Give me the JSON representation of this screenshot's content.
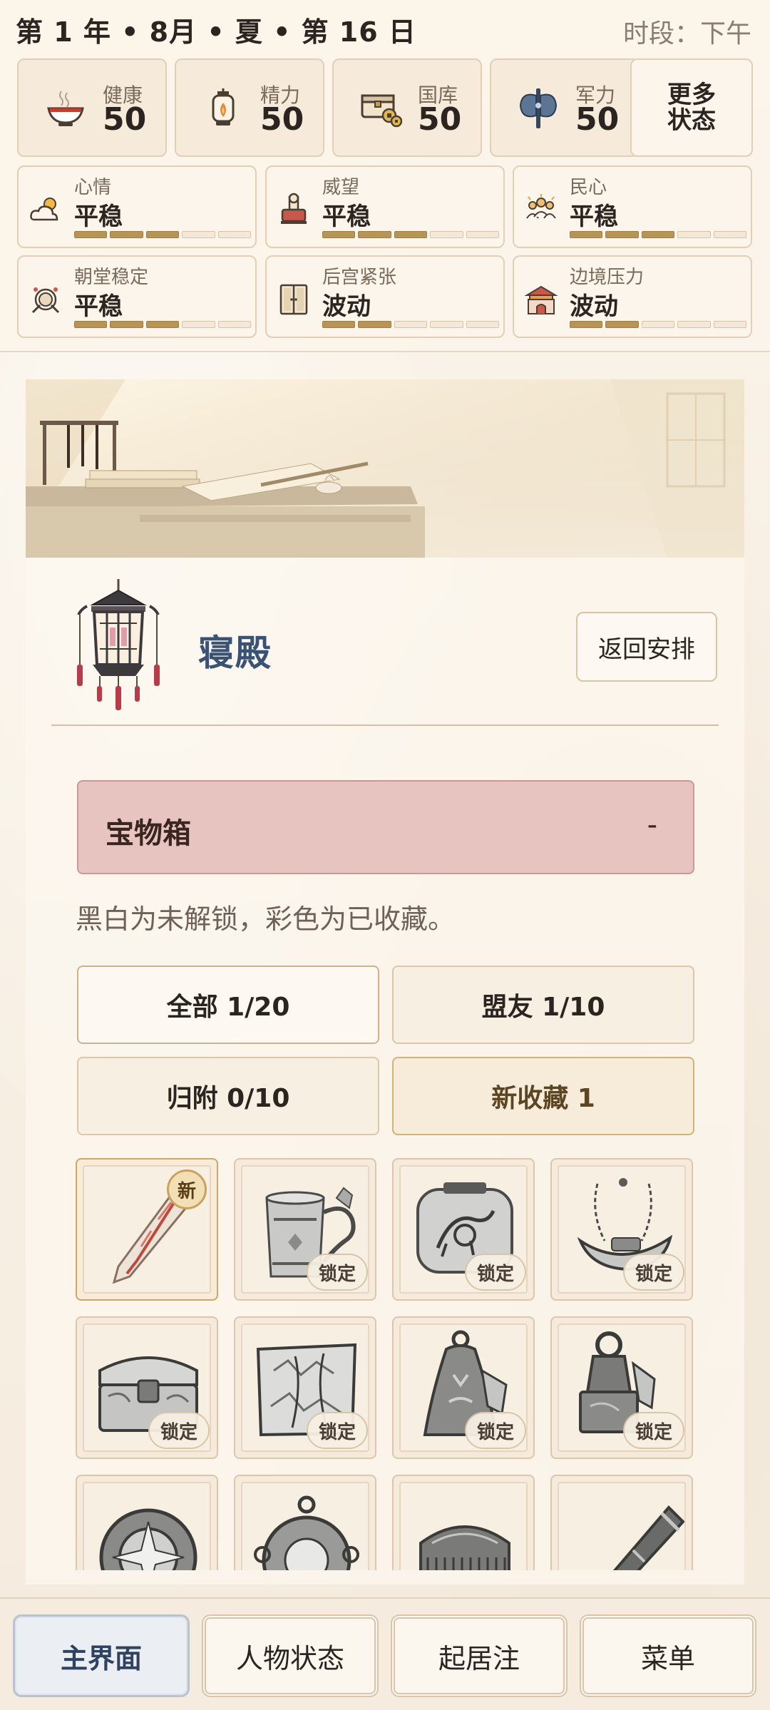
{
  "header": {
    "date": "第 1 年 • 8月 • 夏 • 第 16 日",
    "period": "时段：下午"
  },
  "resources": [
    {
      "icon": "bowl-icon",
      "label": "健康",
      "value": "50"
    },
    {
      "icon": "lantern-icon",
      "label": "精力",
      "value": "50"
    },
    {
      "icon": "treasury-icon",
      "label": "国库",
      "value": "50"
    },
    {
      "icon": "axe-icon",
      "label": "军力",
      "value": "50"
    }
  ],
  "more_status": "更多\n状态",
  "stats": [
    {
      "icon": "weather-icon",
      "label": "心情",
      "value": "平稳",
      "level": 3
    },
    {
      "icon": "seal-icon",
      "label": "威望",
      "value": "平稳",
      "level": 3
    },
    {
      "icon": "people-icon",
      "label": "民心",
      "value": "平稳",
      "level": 3
    },
    {
      "icon": "drum-icon",
      "label": "朝堂稳定",
      "value": "平稳",
      "level": 3
    },
    {
      "icon": "door-icon",
      "label": "后宫紧张",
      "value": "波动",
      "level": 2
    },
    {
      "icon": "gate-icon",
      "label": "边境压力",
      "value": "波动",
      "level": 2
    }
  ],
  "location": {
    "name": "寝殿",
    "back_label": "返回安排"
  },
  "treasure": {
    "title": "宝物箱",
    "toggle": "-",
    "hint": "黑白为未解锁，彩色为已收藏。",
    "filters": [
      {
        "label": "全部 1/20",
        "state": "active"
      },
      {
        "label": "盟友 1/10",
        "state": "normal"
      },
      {
        "label": "归附 0/10",
        "state": "normal"
      },
      {
        "label": "新收藏 1",
        "state": "new"
      }
    ],
    "lock_label": "锁定",
    "new_label": "新",
    "items": [
      {
        "icon": "dagger-icon",
        "owned": true
      },
      {
        "icon": "horse-cup-icon",
        "owned": false
      },
      {
        "icon": "horse-plaque-icon",
        "owned": false
      },
      {
        "icon": "boat-pendant-icon",
        "owned": false
      },
      {
        "icon": "chest-icon",
        "owned": false
      },
      {
        "icon": "map-tablet-icon",
        "owned": false
      },
      {
        "icon": "bell-icon",
        "owned": false
      },
      {
        "icon": "seal-weight-icon",
        "owned": false
      },
      {
        "icon": "compass-icon",
        "owned": false
      },
      {
        "icon": "mirror-icon",
        "owned": false
      },
      {
        "icon": "comb-icon",
        "owned": false
      },
      {
        "icon": "scroll-case-icon",
        "owned": false
      }
    ]
  },
  "nav": [
    {
      "label": "主界面",
      "active": true
    },
    {
      "label": "人物状态",
      "active": false
    },
    {
      "label": "起居注",
      "active": false
    },
    {
      "label": "菜单",
      "active": false
    }
  ]
}
